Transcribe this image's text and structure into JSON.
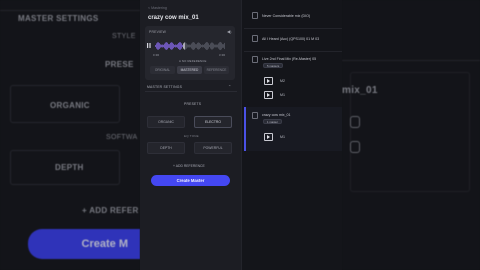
{
  "background_left": {
    "master_settings": "MASTER SETTINGS",
    "style": "STYLE",
    "presets": "PRESE",
    "organic": "ORGANIC",
    "eq": "SOFTWA",
    "depth": "DEPTH",
    "add_reference": "+ ADD REFER",
    "create_button": "Create M"
  },
  "background_right": {
    "track_name": "mix_01"
  },
  "panel": {
    "back_link": "< Mastering",
    "title": "crazy cow mix_01",
    "preview_label": "PREVIEW",
    "time_start": "0:00",
    "time_end": "3:00",
    "reference_toggle": "A  NO REFERENCE",
    "tabs": [
      "ORIGINAL",
      "MASTERED",
      "REFERENCE"
    ],
    "master_settings": "MASTER SETTINGS",
    "presets_label": "PRESETS",
    "options": [
      "ORGANIC",
      "ELECTRO"
    ],
    "eq_label": "EQ TONE",
    "options2": [
      "DEPTH",
      "POWERFUL"
    ],
    "add_reference": "+ ADD REFERENCE",
    "create_button": "Create Master"
  },
  "list": {
    "items": [
      {
        "title": "Never Considerable mix (DIO)"
      },
      {
        "title": "All I Heard (Acc) (QPS100) 01 M 03"
      },
      {
        "title": "Live 2nd Final Mix (Re-Master) 05",
        "badge": "5 masters"
      },
      {
        "title": "crazy cow mix_01",
        "badge": "1 master"
      }
    ],
    "m2": "M2",
    "m1": "M1",
    "m1b": "M1"
  },
  "colors": {
    "accent": "#4447f2",
    "panel": "#1c1d23"
  }
}
